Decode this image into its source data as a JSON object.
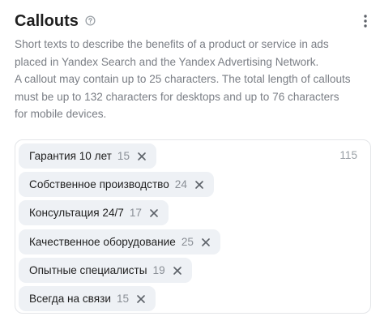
{
  "header": {
    "title": "Callouts",
    "help_icon": "question-circle-icon",
    "menu_icon": "vertical-ellipsis-icon"
  },
  "description": [
    "Short texts to describe the benefits of a product or service in ads",
    "placed in Yandex Search and the Yandex Advertising Network.",
    "A callout may contain up to 25 characters. The total length of callouts",
    "must be up to 132 characters for desktops and up to 76 characters",
    "for mobile devices."
  ],
  "callouts": {
    "total": "115",
    "items": [
      {
        "text": "Гарантия 10 лет",
        "count": "15"
      },
      {
        "text": "Собственное производство",
        "count": "24"
      },
      {
        "text": "Консультация 24/7",
        "count": "17"
      },
      {
        "text": "Качественное оборудование",
        "count": "25"
      },
      {
        "text": "Опытные специалисты",
        "count": "19"
      },
      {
        "text": "Всегда на связи",
        "count": "15"
      }
    ],
    "remove_icon": "close-icon"
  },
  "colors": {
    "chip_background": "#eef1f5",
    "description_text": "#7a7e85",
    "border": "#e3e5e8"
  }
}
